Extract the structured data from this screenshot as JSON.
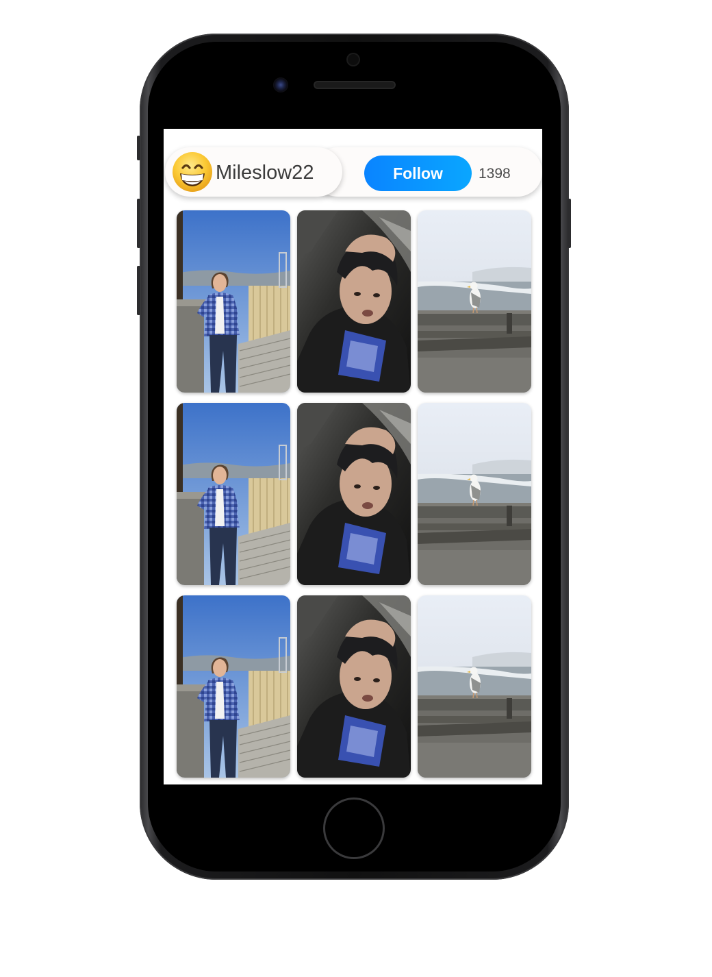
{
  "profile": {
    "avatar_emoji": "grinning-face-with-smiling-eyes",
    "username": "Mileslow22"
  },
  "actions": {
    "follow_label": "Follow",
    "follower_count": "1398",
    "accent_color": "#0a84ff"
  },
  "posts": [
    {
      "subject": "man-on-rooftop-photo"
    },
    {
      "subject": "selfie-hand-on-head-photo"
    },
    {
      "subject": "seagull-on-pier-photo"
    },
    {
      "subject": "man-on-rooftop-photo"
    },
    {
      "subject": "selfie-hand-on-head-photo"
    },
    {
      "subject": "seagull-on-pier-photo"
    },
    {
      "subject": "man-on-rooftop-photo"
    },
    {
      "subject": "selfie-hand-on-head-photo"
    },
    {
      "subject": "seagull-on-pier-photo"
    }
  ]
}
